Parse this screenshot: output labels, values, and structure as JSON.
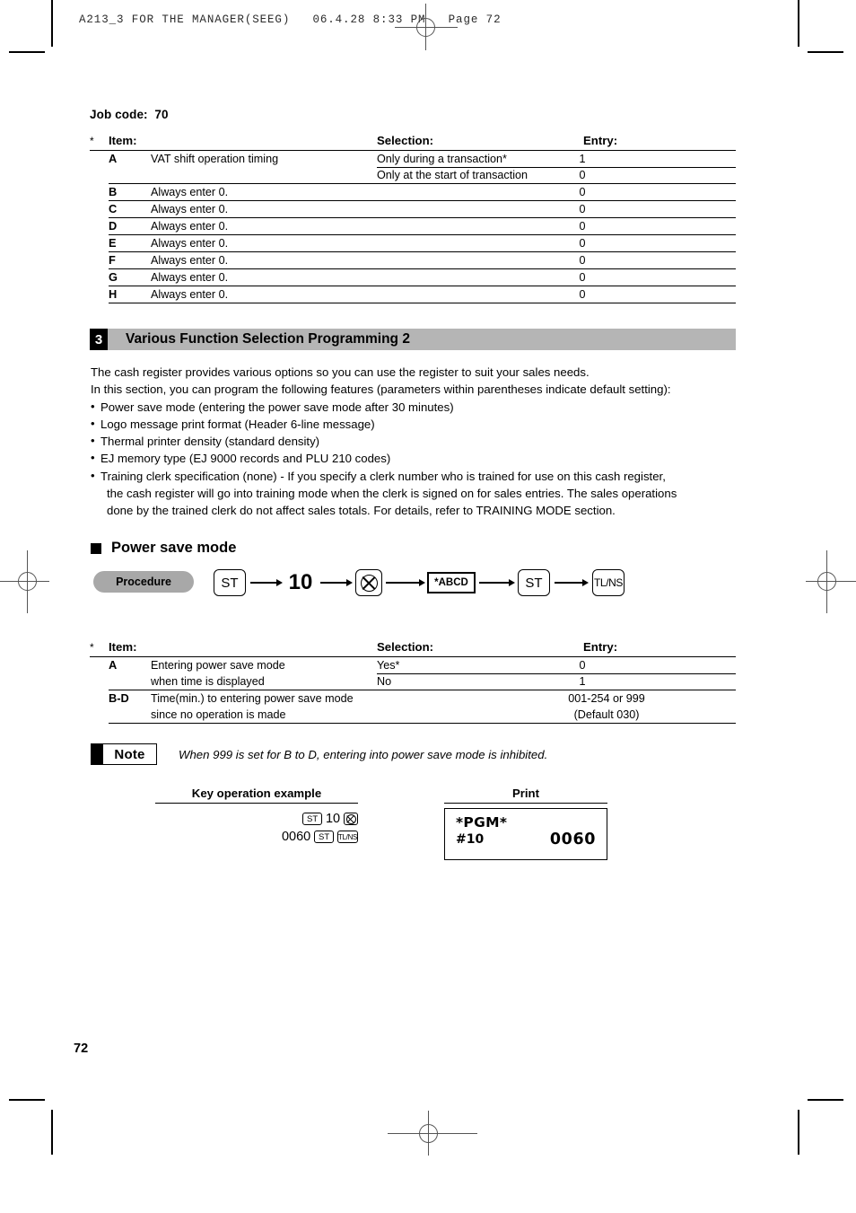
{
  "film_header": "A213_3 FOR THE MANAGER(SEEG)   06.4.28 8:33 PM   Page 72",
  "page_number": "72",
  "job_code": {
    "label": "Job code:",
    "value": "70"
  },
  "table_headers": {
    "star": "*",
    "item": "Item:",
    "selection": "Selection:",
    "entry": "Entry:"
  },
  "job70_rows": [
    {
      "key": "A",
      "desc": "VAT shift operation timing",
      "selection": "Only during a transaction*",
      "entry": "1"
    },
    {
      "key": "",
      "desc": "",
      "selection": "Only at the start of transaction",
      "entry": "0"
    },
    {
      "key": "B",
      "desc": "Always enter 0.",
      "selection": "",
      "entry": "0"
    },
    {
      "key": "C",
      "desc": "Always enter 0.",
      "selection": "",
      "entry": "0"
    },
    {
      "key": "D",
      "desc": "Always enter 0.",
      "selection": "",
      "entry": "0"
    },
    {
      "key": "E",
      "desc": "Always enter 0.",
      "selection": "",
      "entry": "0"
    },
    {
      "key": "F",
      "desc": "Always enter 0.",
      "selection": "",
      "entry": "0"
    },
    {
      "key": "G",
      "desc": "Always enter 0.",
      "selection": "",
      "entry": "0"
    },
    {
      "key": "H",
      "desc": "Always enter 0.",
      "selection": "",
      "entry": "0"
    }
  ],
  "section": {
    "number": "3",
    "title": "Various Function Selection Programming 2"
  },
  "intro": {
    "line1": "The cash register provides various options so you can use the register to suit your sales needs.",
    "line2": "In this section, you can program the following features (parameters within parentheses indicate default setting):",
    "bullet_char": "•",
    "bullets": [
      "Power save mode (entering the power save mode after 30 minutes)",
      "Logo message print format (Header 6-line message)",
      "Thermal printer density (standard density)",
      "EJ memory type (EJ 9000 records and PLU 210 codes)",
      "Training clerk specification (none) - If you specify a clerk number who is trained for use on this cash register,"
    ],
    "continuation": [
      "the cash register will go into training mode when the clerk is signed on for sales entries.  The sales operations",
      "done by the trained clerk do not affect sales totals.  For details, refer to TRAINING MODE section."
    ]
  },
  "subhead": "Power save mode",
  "procedure": {
    "label": "Procedure",
    "steps": [
      {
        "type": "key",
        "label": "ST"
      },
      {
        "type": "text",
        "label": "10"
      },
      {
        "type": "icon",
        "label": "multiply-circle-icon"
      },
      {
        "type": "box",
        "label": "*ABCD"
      },
      {
        "type": "key",
        "label": "ST"
      },
      {
        "type": "key",
        "label": "TL/NS"
      }
    ]
  },
  "powersave_rows": [
    {
      "key": "A",
      "desc": "Entering power save mode",
      "selection": "Yes*",
      "entry": "0"
    },
    {
      "key": "",
      "desc": "when time is displayed",
      "selection": "No",
      "entry": "1"
    },
    {
      "key": "B-D",
      "desc": "Time(min.) to entering power save mode",
      "selection": "",
      "entry": "001-254 or 999"
    },
    {
      "key": "",
      "desc": "since no operation is made",
      "selection": "",
      "entry": "(Default 030)"
    }
  ],
  "note": {
    "label": "Note",
    "text": "When 999 is set for B to D, entering into power save mode is inhibited."
  },
  "example": {
    "key_title": "Key operation example",
    "print_title": "Print",
    "keys_line1": {
      "k1": "ST",
      "num": "10",
      "k2": "multiply-circle-icon"
    },
    "keys_line2": {
      "num": "0060",
      "k1": "ST",
      "k2": "TL/NS"
    }
  },
  "print_receipt": {
    "line1": "*PGM*",
    "line2_left": "#10",
    "line2_right": "0060"
  },
  "colors": {
    "banner_gray": "#b5b5b5",
    "pill_gray": "#a8a8a8",
    "ink": "#000000",
    "reg_mark": "#555555"
  }
}
